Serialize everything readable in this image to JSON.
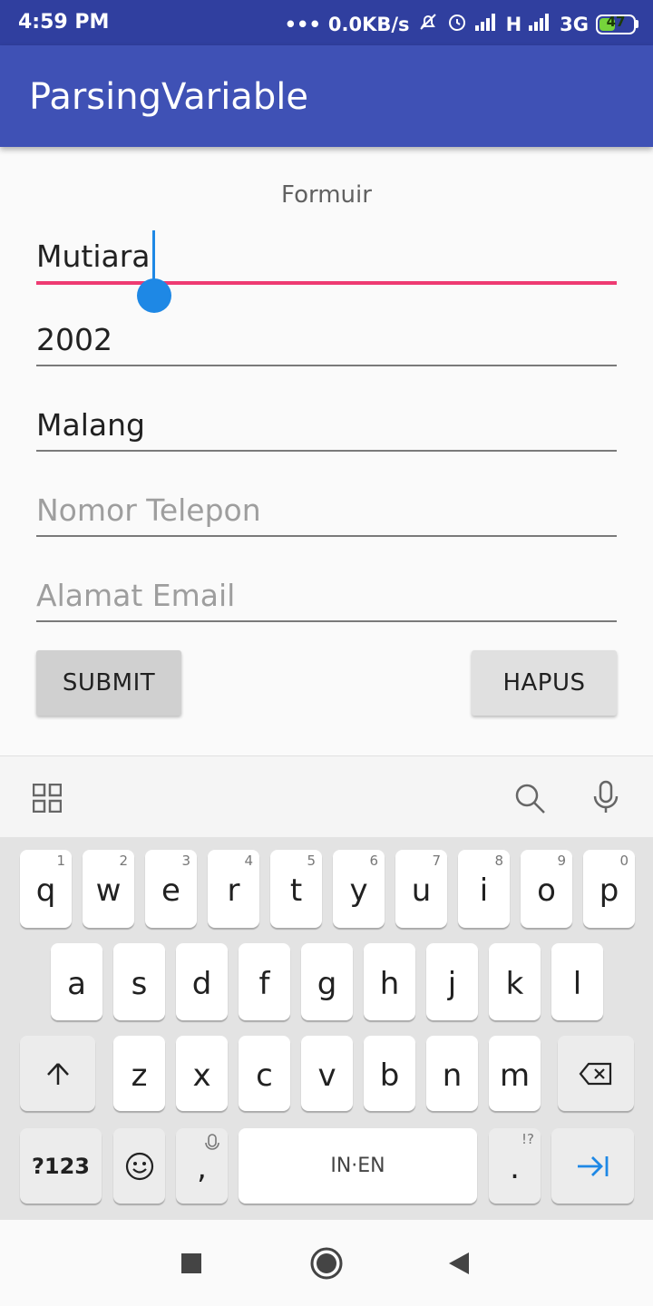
{
  "status_bar": {
    "time": "4:59 PM",
    "dots": "•••",
    "speed": "0.0KB/s",
    "network_1": "H",
    "network_2": "3G",
    "battery_level": "47"
  },
  "app_bar": {
    "title": "ParsingVariable"
  },
  "form": {
    "heading": "Formuir",
    "fields": [
      {
        "value": "Mutiara",
        "placeholder": ""
      },
      {
        "value": "2002",
        "placeholder": ""
      },
      {
        "value": "Malang",
        "placeholder": ""
      },
      {
        "value": "",
        "placeholder": "Nomor Telepon"
      },
      {
        "value": "",
        "placeholder": "Alamat Email"
      }
    ],
    "submit_label": "SUBMIT",
    "hapus_label": "HAPUS"
  },
  "keyboard": {
    "row1": [
      {
        "key": "q",
        "hint": "1"
      },
      {
        "key": "w",
        "hint": "2"
      },
      {
        "key": "e",
        "hint": "3"
      },
      {
        "key": "r",
        "hint": "4"
      },
      {
        "key": "t",
        "hint": "5"
      },
      {
        "key": "y",
        "hint": "6"
      },
      {
        "key": "u",
        "hint": "7"
      },
      {
        "key": "i",
        "hint": "8"
      },
      {
        "key": "o",
        "hint": "9"
      },
      {
        "key": "p",
        "hint": "0"
      }
    ],
    "row2": [
      "a",
      "s",
      "d",
      "f",
      "g",
      "h",
      "j",
      "k",
      "l"
    ],
    "row3": [
      "z",
      "x",
      "c",
      "v",
      "b",
      "n",
      "m"
    ],
    "symbols_label": "?123",
    "comma_label": ",",
    "space_label": "IN·EN",
    "period_label": ".",
    "period_hint": "!?",
    "accent_color": "#1e88e5"
  },
  "colors": {
    "status_bar": "#303f9f",
    "app_bar": "#3f51b5",
    "focus_line": "#ee3b72",
    "caret": "#1e88e5"
  }
}
